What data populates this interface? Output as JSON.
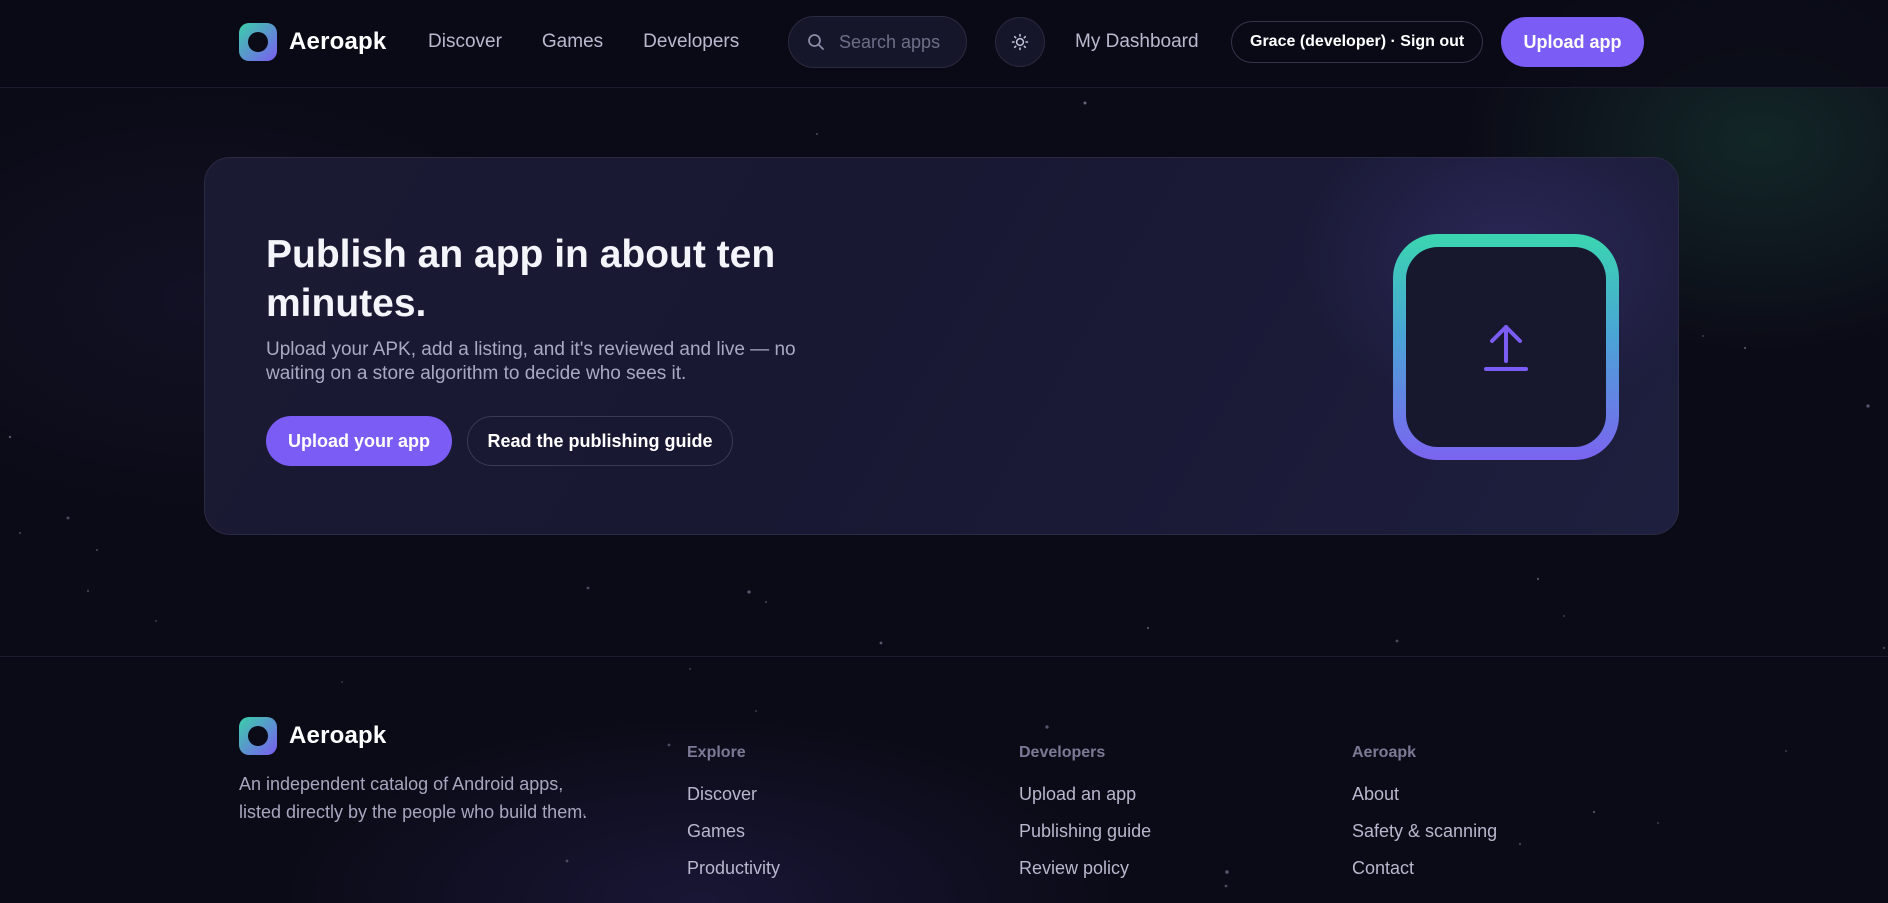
{
  "header": {
    "brand": "Aeroapk",
    "nav": [
      "Discover",
      "Games",
      "Developers"
    ],
    "search_placeholder": "Search apps",
    "dashboard_link": "My Dashboard",
    "user_button": "Grace (developer) · Sign out",
    "upload_button": "Upload app"
  },
  "hero": {
    "title": "Publish an app in about ten minutes.",
    "subtitle": "Upload your APK, add a listing, and it's reviewed and live — no waiting on a store algorithm to decide who sees it.",
    "primary_button": "Upload your app",
    "secondary_button": "Read the publishing guide"
  },
  "footer": {
    "brand": "Aeroapk",
    "description": "An independent catalog of Android apps, listed directly by the people who build them.",
    "columns": [
      {
        "heading": "Explore",
        "links": [
          "Discover",
          "Games",
          "Productivity"
        ]
      },
      {
        "heading": "Developers",
        "links": [
          "Upload an app",
          "Publishing guide",
          "Review policy"
        ]
      },
      {
        "heading": "Aeroapk",
        "links": [
          "About",
          "Safety & scanning",
          "Contact"
        ]
      }
    ]
  },
  "colors": {
    "background": "#0b0b17",
    "accent": "#7b5cf5",
    "logo_gradient_start": "#3ad0a8",
    "logo_gradient_end": "#7a5cf2"
  },
  "icons": [
    "logo-mark-icon",
    "search-icon",
    "sun-icon",
    "upload-arrow-icon"
  ]
}
